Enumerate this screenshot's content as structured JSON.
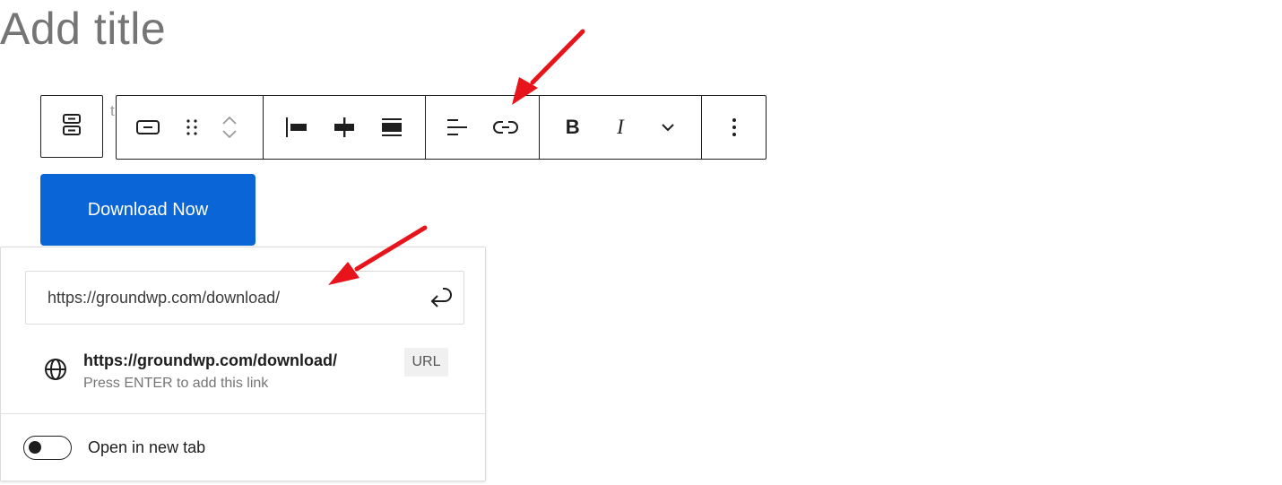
{
  "editor": {
    "title_placeholder": "Add title",
    "ghost_text": "t"
  },
  "toolbar": {
    "block_type_icon": "buttons-block-icon",
    "groups": [
      [
        "button-block-icon",
        "drag-handle-icon",
        "move-up-icon",
        "move-down-icon"
      ],
      [
        "justify-left-icon",
        "justify-center-icon",
        "justify-space-between-icon"
      ],
      [
        "align-text-left-icon",
        "link-icon"
      ],
      [
        "bold-icon",
        "italic-icon",
        "more-rich-text-controls-icon"
      ],
      [
        "options-icon"
      ]
    ],
    "bold_label": "B",
    "italic_label": "I"
  },
  "button_block": {
    "label": "Download Now",
    "color": "#0a66d6"
  },
  "link_popover": {
    "url_value": "https://groundwp.com/download/",
    "submit_icon": "enter-icon",
    "suggestion": {
      "icon": "globe-icon",
      "title": "https://groundwp.com/download/",
      "hint": "Press ENTER to add this link",
      "type": "URL"
    },
    "new_tab": {
      "label": "Open in new tab",
      "enabled": false
    }
  },
  "annotations": {
    "arrow_color": "#e8141b"
  }
}
